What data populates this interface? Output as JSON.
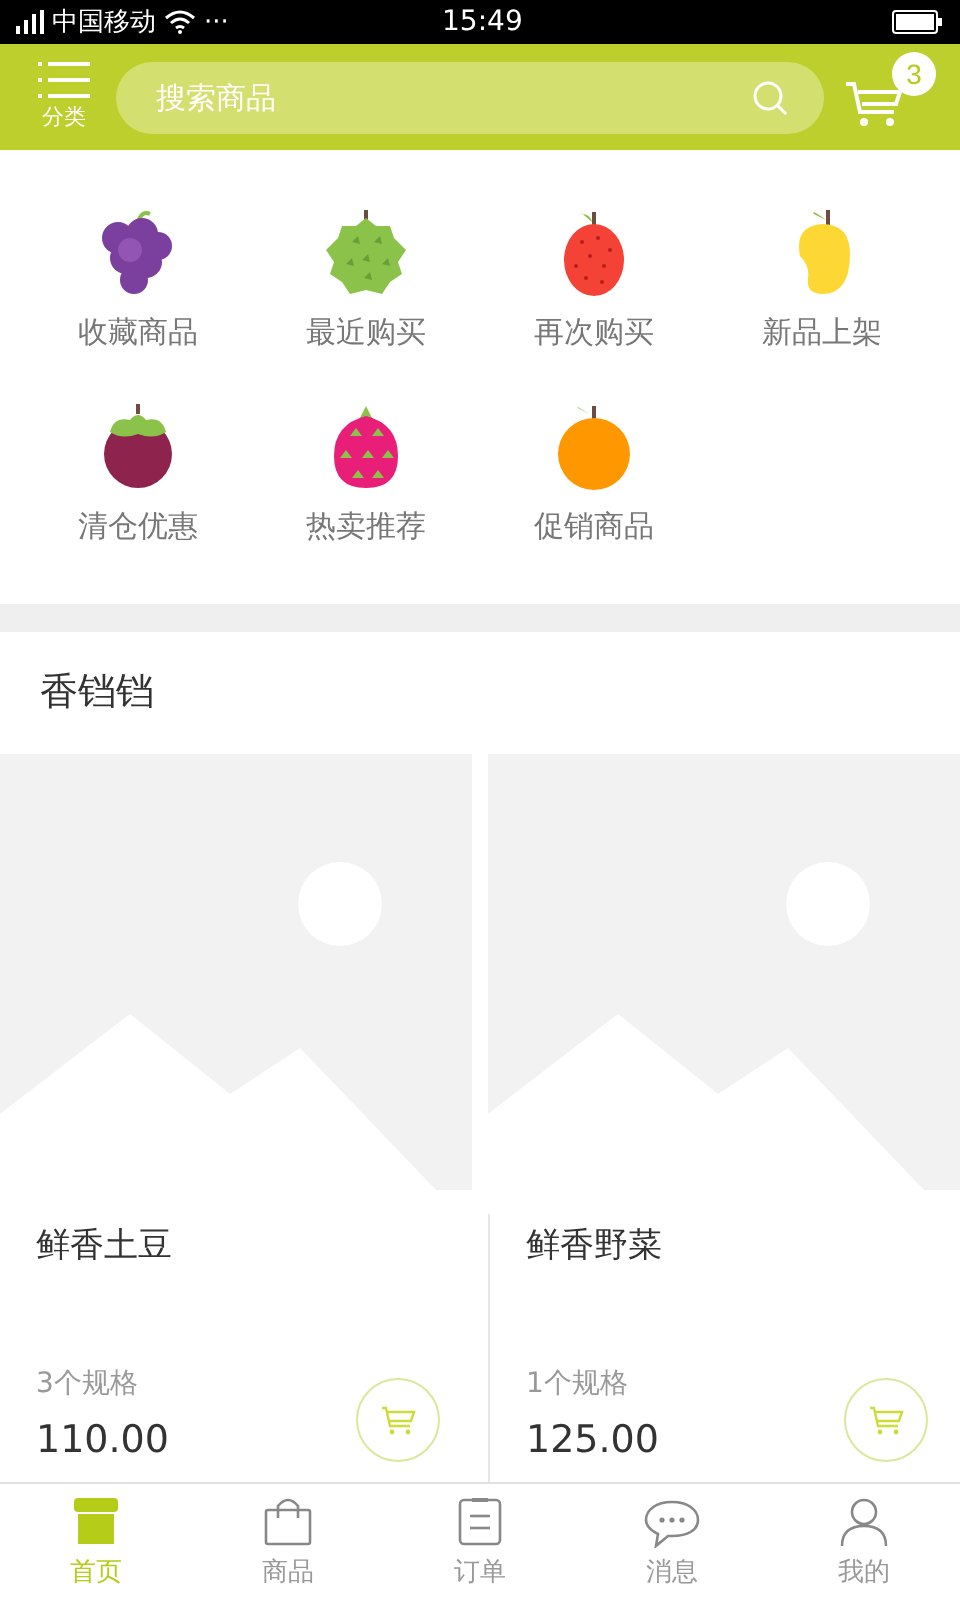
{
  "status_bar": {
    "carrier": "中国移动",
    "more": "···",
    "time": "15:49"
  },
  "header": {
    "menu_label": "分类",
    "search": {
      "placeholder": "搜索商品"
    },
    "cart_count": "3"
  },
  "categories": [
    {
      "label": "收藏商品",
      "kind": "grape"
    },
    {
      "label": "最近购买",
      "kind": "durian"
    },
    {
      "label": "再次购买",
      "kind": "lychee"
    },
    {
      "label": "新品上架",
      "kind": "mango"
    },
    {
      "label": "清仓优惠",
      "kind": "mangosteen"
    },
    {
      "label": "热卖推荐",
      "kind": "dragonfruit"
    },
    {
      "label": "促销商品",
      "kind": "orange"
    }
  ],
  "section": {
    "title": "香铛铛"
  },
  "products": [
    {
      "name": "鲜香土豆",
      "spec": "3个规格",
      "price": "110.00"
    },
    {
      "name": "鲜香野菜",
      "spec": "1个规格",
      "price": "125.00"
    }
  ],
  "tabs": [
    {
      "label": "首页",
      "kind": "home",
      "selected": true
    },
    {
      "label": "商品",
      "kind": "bag",
      "selected": false
    },
    {
      "label": "订单",
      "kind": "list",
      "selected": false
    },
    {
      "label": "消息",
      "kind": "chat",
      "selected": false
    },
    {
      "label": "我的",
      "kind": "person",
      "selected": false
    }
  ]
}
